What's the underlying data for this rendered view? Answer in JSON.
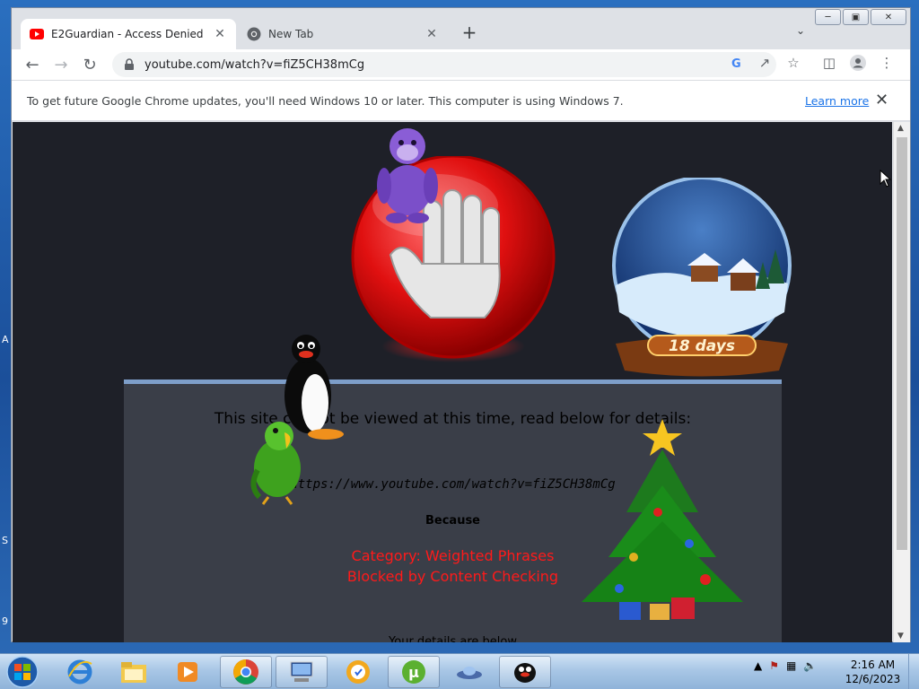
{
  "browser": {
    "tabs": [
      {
        "title": "E2Guardian - Access Denied",
        "favicon": "youtube-icon",
        "active": true
      },
      {
        "title": "New Tab",
        "favicon": "chrome-icon",
        "active": false
      }
    ],
    "url": "youtube.com/watch?v=fiZ5CH38mCg",
    "infobar": {
      "message": "To get future Google Chrome updates, you'll need Windows 10 or later. This computer is using Windows 7.",
      "link": "Learn more"
    }
  },
  "page": {
    "headline": "This site cannot be viewed at this time, read below for details:",
    "blocked_url": "https://www.youtube.com/watch?v=fiZ5CH38mCg",
    "because": "Because",
    "reason_line1": "Category: Weighted Phrases",
    "reason_line2": "Blocked by Content Checking",
    "details": "Your details are below",
    "countdown": "18 days"
  },
  "desktop": {
    "edge_letters": [
      "A",
      "S",
      "9"
    ]
  },
  "taskbar": {
    "pinned": [
      "internet-explorer-icon",
      "file-explorer-icon",
      "media-player-icon",
      "chrome-icon",
      "remote-desktop-icon",
      "security-app-icon",
      "utorrent-icon",
      "ufo-app-icon",
      "pingu-app-icon"
    ],
    "time": "2:16 AM",
    "date": "12/6/2023"
  },
  "colors": {
    "content_bg": "#1e2028",
    "panel_bg": "#3a3e48",
    "reason_red": "#ff1a1a",
    "link_blue": "#1a73e8"
  }
}
